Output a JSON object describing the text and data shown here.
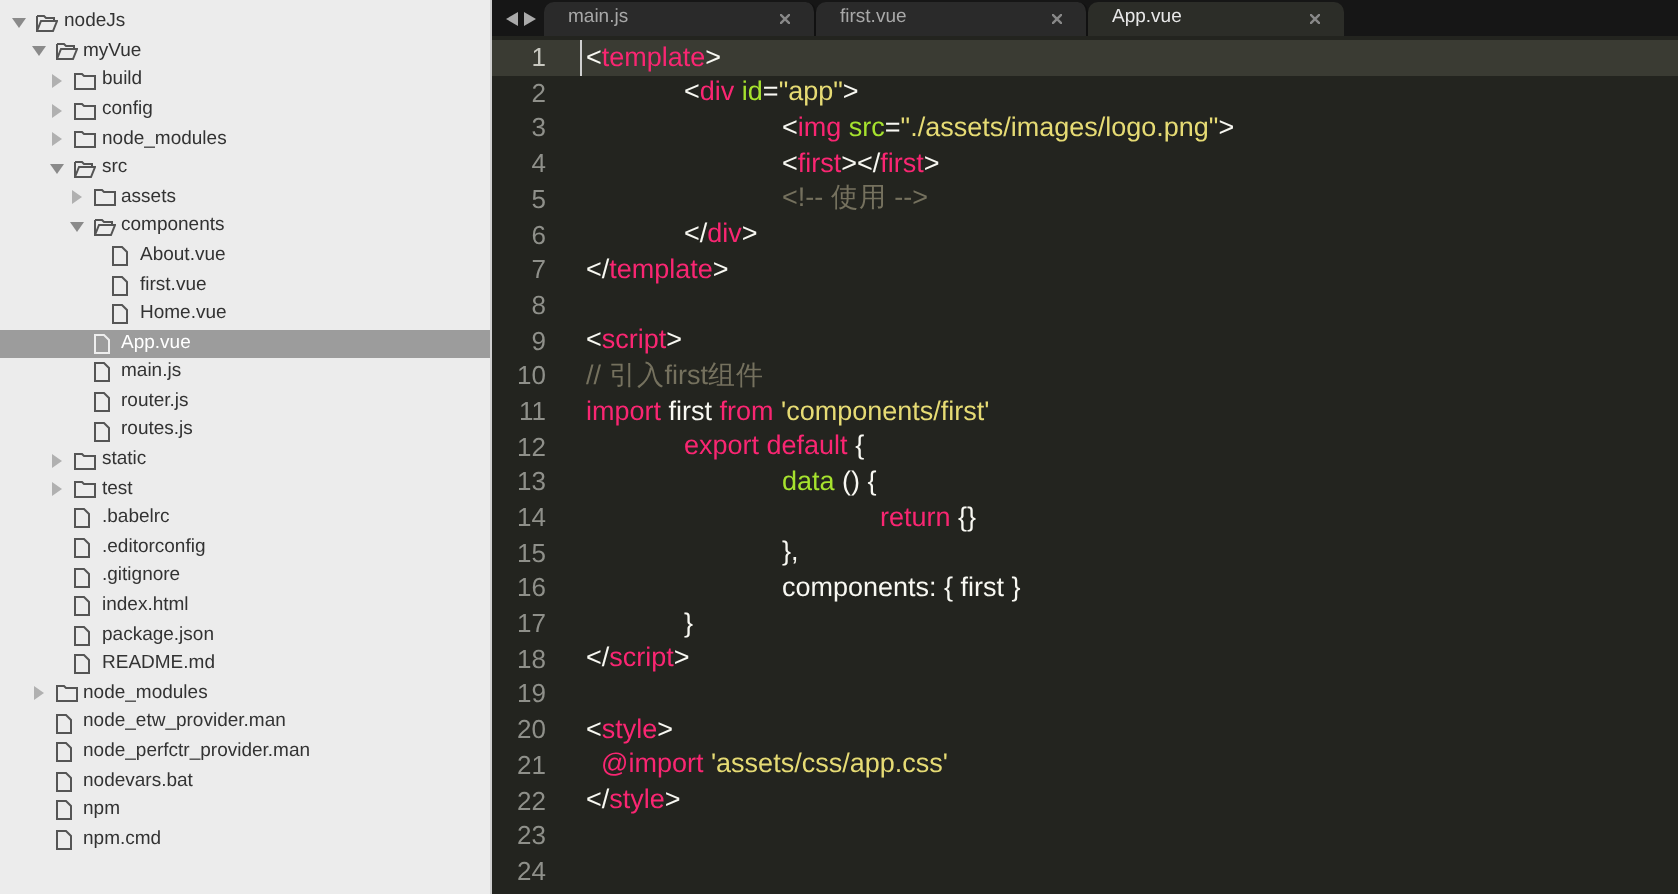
{
  "sidebar": {
    "tree": [
      {
        "label": "nodeJs",
        "kind": "folder",
        "expanded": true,
        "selected": false,
        "children": [
          {
            "label": "myVue",
            "kind": "folder",
            "expanded": true,
            "selected": false,
            "children": [
              {
                "label": "build",
                "kind": "folder",
                "expanded": false,
                "selected": false
              },
              {
                "label": "config",
                "kind": "folder",
                "expanded": false,
                "selected": false
              },
              {
                "label": "node_modules",
                "kind": "folder",
                "expanded": false,
                "selected": false
              },
              {
                "label": "src",
                "kind": "folder",
                "expanded": true,
                "selected": false,
                "children": [
                  {
                    "label": "assets",
                    "kind": "folder",
                    "expanded": false,
                    "selected": false
                  },
                  {
                    "label": "components",
                    "kind": "folder",
                    "expanded": true,
                    "selected": false,
                    "children": [
                      {
                        "label": "About.vue",
                        "kind": "file",
                        "selected": false
                      },
                      {
                        "label": "first.vue",
                        "kind": "file",
                        "selected": false
                      },
                      {
                        "label": "Home.vue",
                        "kind": "file",
                        "selected": false
                      }
                    ]
                  },
                  {
                    "label": "App.vue",
                    "kind": "file",
                    "selected": true
                  },
                  {
                    "label": "main.js",
                    "kind": "file",
                    "selected": false
                  },
                  {
                    "label": "router.js",
                    "kind": "file",
                    "selected": false
                  },
                  {
                    "label": "routes.js",
                    "kind": "file",
                    "selected": false
                  }
                ]
              },
              {
                "label": "static",
                "kind": "folder",
                "expanded": false,
                "selected": false
              },
              {
                "label": "test",
                "kind": "folder",
                "expanded": false,
                "selected": false
              },
              {
                "label": ".babelrc",
                "kind": "file",
                "selected": false
              },
              {
                "label": ".editorconfig",
                "kind": "file",
                "selected": false
              },
              {
                "label": ".gitignore",
                "kind": "file",
                "selected": false
              },
              {
                "label": "index.html",
                "kind": "file",
                "selected": false
              },
              {
                "label": "package.json",
                "kind": "file",
                "selected": false
              },
              {
                "label": "README.md",
                "kind": "file",
                "selected": false
              }
            ]
          },
          {
            "label": "node_modules",
            "kind": "folder",
            "expanded": false,
            "selected": false
          },
          {
            "label": "node_etw_provider.man",
            "kind": "file",
            "selected": false
          },
          {
            "label": "node_perfctr_provider.man",
            "kind": "file",
            "selected": false
          },
          {
            "label": "nodevars.bat",
            "kind": "file",
            "selected": false
          },
          {
            "label": "npm",
            "kind": "file",
            "selected": false
          },
          {
            "label": "npm.cmd",
            "kind": "file",
            "selected": false
          }
        ]
      }
    ]
  },
  "tabs": [
    {
      "label": "main.js",
      "selected": false
    },
    {
      "label": "first.vue",
      "selected": false
    },
    {
      "label": "App.vue",
      "selected": true
    }
  ],
  "editor": {
    "lines": [
      {
        "number": "1",
        "current": true,
        "tokens": [
          {
            "kind": "punct",
            "text": "<"
          },
          {
            "kind": "tag",
            "text": "template"
          },
          {
            "kind": "punct",
            "text": ">"
          }
        ]
      },
      {
        "number": "2",
        "current": false,
        "tokens": [
          {
            "kind": "punct",
            "text": "\t<"
          },
          {
            "kind": "tag",
            "text": "div"
          },
          {
            "kind": "attr",
            "text": " id"
          },
          {
            "kind": "punct",
            "text": "="
          },
          {
            "kind": "string",
            "text": "\"app\""
          },
          {
            "kind": "punct",
            "text": ">"
          }
        ]
      },
      {
        "number": "3",
        "current": false,
        "tokens": [
          {
            "kind": "punct",
            "text": "\t\t<"
          },
          {
            "kind": "tag",
            "text": "img"
          },
          {
            "kind": "attr",
            "text": " src"
          },
          {
            "kind": "punct",
            "text": "="
          },
          {
            "kind": "string",
            "text": "\"./assets/images/logo.png\""
          },
          {
            "kind": "punct",
            "text": ">"
          }
        ]
      },
      {
        "number": "4",
        "current": false,
        "tokens": [
          {
            "kind": "punct",
            "text": "\t\t<"
          },
          {
            "kind": "tag",
            "text": "first"
          },
          {
            "kind": "punct",
            "text": "></"
          },
          {
            "kind": "tag",
            "text": "first"
          },
          {
            "kind": "punct",
            "text": ">"
          }
        ]
      },
      {
        "number": "5",
        "current": false,
        "tokens": [
          {
            "kind": "comment",
            "text": "\t\t<!-- 使用 -->"
          }
        ]
      },
      {
        "number": "6",
        "current": false,
        "tokens": [
          {
            "kind": "punct",
            "text": "\t</"
          },
          {
            "kind": "tag",
            "text": "div"
          },
          {
            "kind": "punct",
            "text": ">"
          }
        ]
      },
      {
        "number": "7",
        "current": false,
        "tokens": [
          {
            "kind": "punct",
            "text": "</"
          },
          {
            "kind": "tag",
            "text": "template"
          },
          {
            "kind": "punct",
            "text": ">"
          }
        ]
      },
      {
        "number": "8",
        "current": false
      },
      {
        "number": "9",
        "current": false,
        "tokens": [
          {
            "kind": "punct",
            "text": "<"
          },
          {
            "kind": "tag",
            "text": "script"
          },
          {
            "kind": "punct",
            "text": ">"
          }
        ]
      },
      {
        "number": "10",
        "current": false,
        "tokens": [
          {
            "kind": "comment",
            "text": "// 引入first组件"
          }
        ]
      },
      {
        "number": "11",
        "current": false,
        "tokens": [
          {
            "kind": "tag",
            "text": "import"
          },
          {
            "kind": "plain",
            "text": " first "
          },
          {
            "kind": "tag",
            "text": "from"
          },
          {
            "kind": "string",
            "text": " 'components/first'"
          }
        ]
      },
      {
        "number": "12",
        "current": false,
        "tokens": [
          {
            "kind": "tag",
            "text": "\texport default"
          },
          {
            "kind": "plain",
            "text": " {"
          }
        ]
      },
      {
        "number": "13",
        "current": false,
        "tokens": [
          {
            "kind": "attr",
            "text": "\t\tdata"
          },
          {
            "kind": "plain",
            "text": " () {"
          }
        ]
      },
      {
        "number": "14",
        "current": false,
        "tokens": [
          {
            "kind": "tag",
            "text": "\t\t\treturn"
          },
          {
            "kind": "plain",
            "text": " {}"
          }
        ]
      },
      {
        "number": "15",
        "current": false,
        "tokens": [
          {
            "kind": "plain",
            "text": "\t\t},"
          }
        ]
      },
      {
        "number": "16",
        "current": false,
        "tokens": [
          {
            "kind": "plain",
            "text": "\t\tcomponents: { first }"
          }
        ]
      },
      {
        "number": "17",
        "current": false,
        "tokens": [
          {
            "kind": "plain",
            "text": "\t}"
          }
        ]
      },
      {
        "number": "18",
        "current": false,
        "tokens": [
          {
            "kind": "punct",
            "text": "</"
          },
          {
            "kind": "tag",
            "text": "script"
          },
          {
            "kind": "punct",
            "text": ">"
          }
        ]
      },
      {
        "number": "19",
        "current": false
      },
      {
        "number": "20",
        "current": false,
        "tokens": [
          {
            "kind": "punct",
            "text": "<"
          },
          {
            "kind": "tag",
            "text": "style"
          },
          {
            "kind": "punct",
            "text": ">"
          }
        ]
      },
      {
        "number": "21",
        "current": false,
        "tokens": [
          {
            "kind": "tag",
            "text": "  @import"
          },
          {
            "kind": "string",
            "text": " 'assets/css/app.css'"
          }
        ]
      },
      {
        "number": "22",
        "current": false,
        "tokens": [
          {
            "kind": "punct",
            "text": "</"
          },
          {
            "kind": "tag",
            "text": "style"
          },
          {
            "kind": "punct",
            "text": ">"
          }
        ]
      },
      {
        "number": "23",
        "current": false
      },
      {
        "number": "24",
        "current": false
      }
    ]
  }
}
